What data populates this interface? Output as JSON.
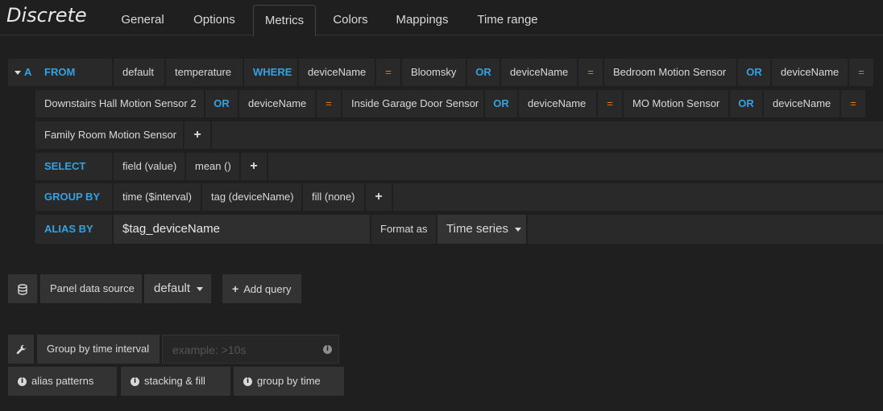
{
  "app": {
    "title": "Discrete"
  },
  "tabs": [
    {
      "label": "General"
    },
    {
      "label": "Options"
    },
    {
      "label": "Metrics"
    },
    {
      "label": "Colors"
    },
    {
      "label": "Mappings"
    },
    {
      "label": "Time range"
    }
  ],
  "query": {
    "letter": "A",
    "from_kw": "FROM",
    "retention": "default",
    "measurement": "temperature",
    "where_kw": "WHERE",
    "eq": "=",
    "or": "OR",
    "tag_key": "deviceName",
    "conditions": [
      "Bloomsky",
      "Bedroom Motion Sensor",
      "Downstairs Hall Motion Sensor 2",
      "Inside Garage Door Sensor",
      "MO Motion Sensor",
      "Family Room Motion Sensor"
    ],
    "select_kw": "SELECT",
    "select_field": "field (value)",
    "select_fn": "mean ()",
    "groupby_kw": "GROUP BY",
    "groupby_time": "time ($interval)",
    "groupby_tag": "tag (deviceName)",
    "groupby_fill": "fill (none)",
    "alias_kw": "ALIAS BY",
    "alias_value": "$tag_deviceName",
    "format_label": "Format as",
    "format_value": "Time series",
    "plus": "+"
  },
  "datasource": {
    "label": "Panel data source",
    "value": "default",
    "add_query": "Add query"
  },
  "options": {
    "group_interval_label": "Group by time interval",
    "group_interval_placeholder": "example: >10s",
    "help": [
      "alias patterns",
      "stacking & fill",
      "group by time"
    ]
  },
  "colors": {
    "keyword": "#33a2e5",
    "operator": "#eb7b18",
    "background": "#1f1f20",
    "segment": "#292929"
  }
}
